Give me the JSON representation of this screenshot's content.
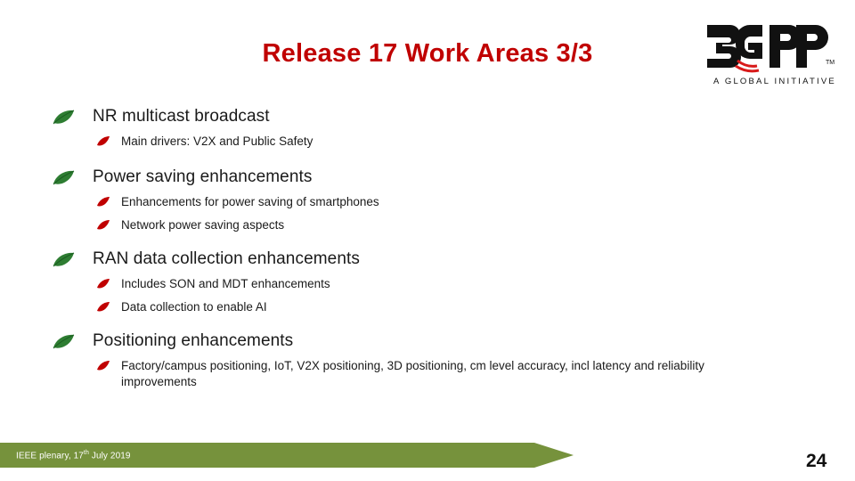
{
  "title": "Release 17 Work Areas 3/3",
  "logo": {
    "name": "3gpp-logo",
    "main": "3GPP",
    "tagline": "A GLOBAL INITIATIVE",
    "trademark": "TM"
  },
  "content": {
    "groups": [
      {
        "heading": "NR multicast broadcast",
        "items": [
          "Main drivers: V2X and Public Safety"
        ]
      },
      {
        "heading": "Power saving enhancements",
        "items": [
          "Enhancements for power saving of smartphones",
          "Network power saving aspects"
        ]
      },
      {
        "heading": "RAN data collection enhancements",
        "items": [
          "Includes SON and MDT enhancements",
          "Data collection to enable AI"
        ]
      },
      {
        "heading": "Positioning enhancements",
        "items": [
          "Factory/campus positioning, IoT, V2X positioning, 3D positioning, cm level accuracy, incl latency and reliability improvements"
        ]
      }
    ]
  },
  "footer": {
    "event": "IEEE plenary,",
    "date_day": "17",
    "date_sup": "th",
    "date_rest": " July 2019",
    "page_number": "24"
  },
  "colors": {
    "title": "#C00000",
    "footer_bar": "#76923C",
    "bullet_green": "#2E7D32",
    "bullet_red": "#C00000"
  }
}
